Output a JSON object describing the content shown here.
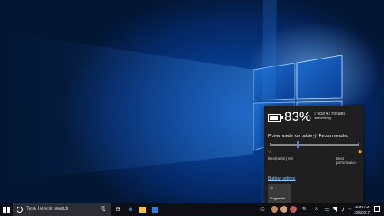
{
  "battery_flyout": {
    "percent": "83%",
    "remaining": "6 hour 42 minutes remaining",
    "power_mode_label": "Power mode (on battery): Recommended",
    "power_slider_value_percent": 30,
    "left_caption": "Best battery life",
    "right_caption": "Best performance",
    "settings_link": "Battery settings",
    "quick_action_label": "Suggested"
  },
  "taskbar": {
    "search_placeholder": "Type here to search",
    "clock_time": "10:37 AM",
    "clock_date": "10/6/2017"
  },
  "icons": {
    "battery": "battery-icon",
    "leaf": "leaf-icon",
    "bolt": "bolt-icon",
    "start": "windows-logo-icon",
    "cortana": "cortana-icon",
    "mic": "microphone-icon",
    "task_view": "task-view-icon",
    "edge": "edge-icon",
    "explorer": "folder-icon",
    "store": "store-icon",
    "people": "people-icon",
    "pen": "pen-icon",
    "chevron": "chevron-up-icon",
    "network": "network-icon",
    "volume": "volume-icon",
    "action_center": "action-center-icon"
  },
  "colors": {
    "accent": "#3a8fe0",
    "flyout_bg": "#1f1f1f",
    "taskbar_bg": "#0d0f14"
  }
}
